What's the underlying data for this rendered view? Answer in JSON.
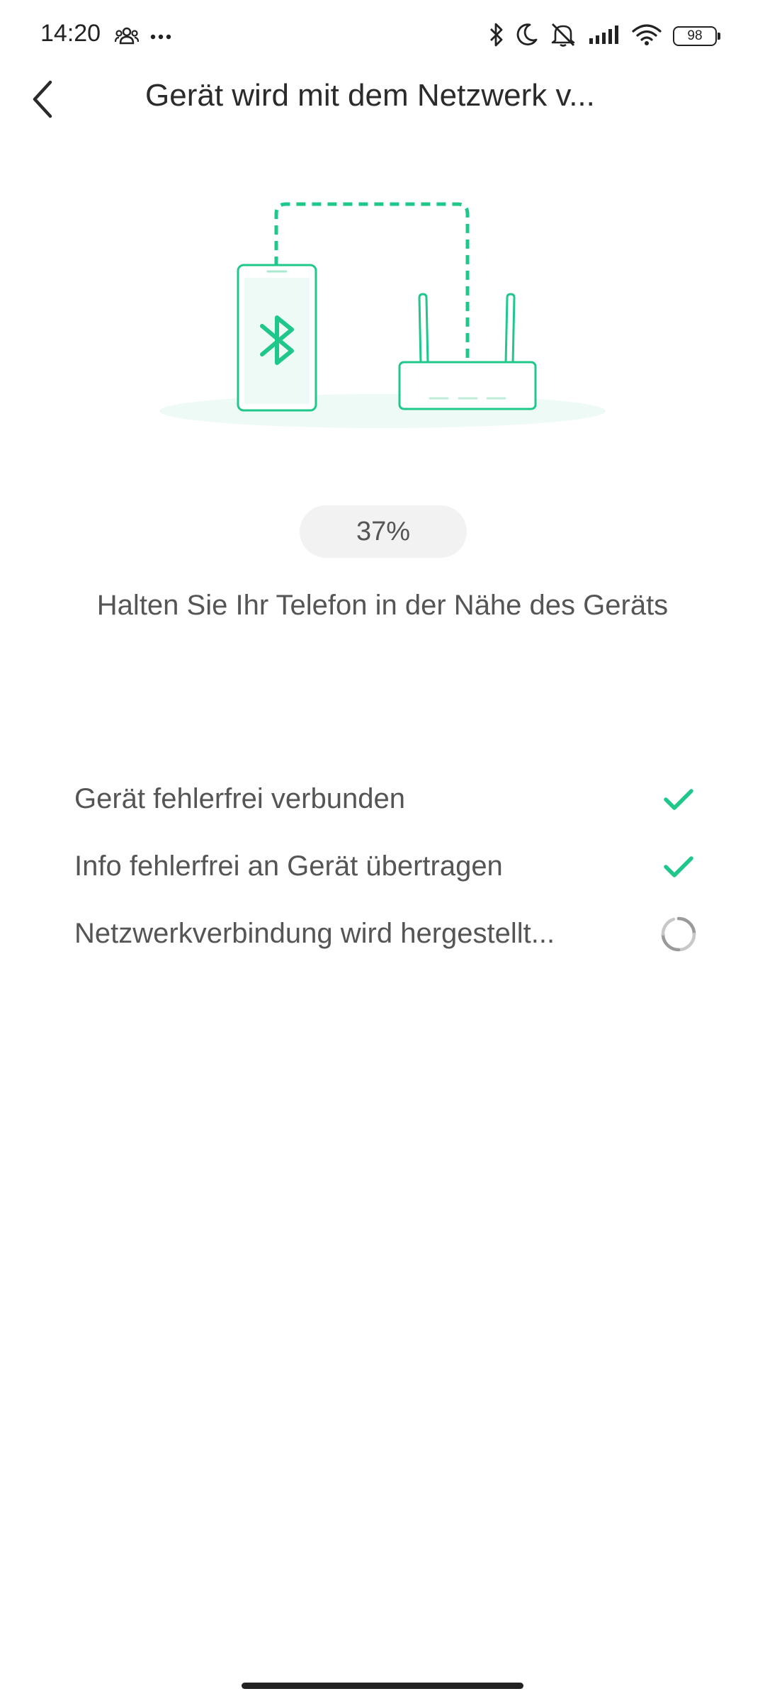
{
  "status_bar": {
    "time": "14:20",
    "battery_level": "98",
    "left_icons": [
      "people-icon",
      "more-dots-icon"
    ],
    "right_icons": [
      "bluetooth-icon",
      "moon-icon",
      "bell-muted-icon",
      "signal-icon",
      "wifi-icon",
      "battery-icon"
    ]
  },
  "header": {
    "back_icon": "chevron-left-icon",
    "title": "Gerät wird mit dem Netzwerk v..."
  },
  "illustration": {
    "accent_color": "#2ecc8f",
    "icons": [
      "phone-icon",
      "bluetooth-icon",
      "router-icon"
    ]
  },
  "progress": {
    "label": "37%",
    "value": 0.37
  },
  "hint": "Halten Sie Ihr Telefon in der Nähe des Geräts",
  "steps": [
    {
      "label": "Gerät fehlerfrei verbunden",
      "status": "done",
      "icon": "check-icon"
    },
    {
      "label": "Info fehlerfrei an Gerät übertragen",
      "status": "done",
      "icon": "check-icon"
    },
    {
      "label": "Netzwerkverbindung wird hergestellt...",
      "status": "loading",
      "icon": "spinner-icon"
    }
  ],
  "colors": {
    "accent": "#1fc88a",
    "text_primary": "#2b2b2b",
    "text_secondary": "#555555",
    "pill_background": "#f2f2f2"
  }
}
